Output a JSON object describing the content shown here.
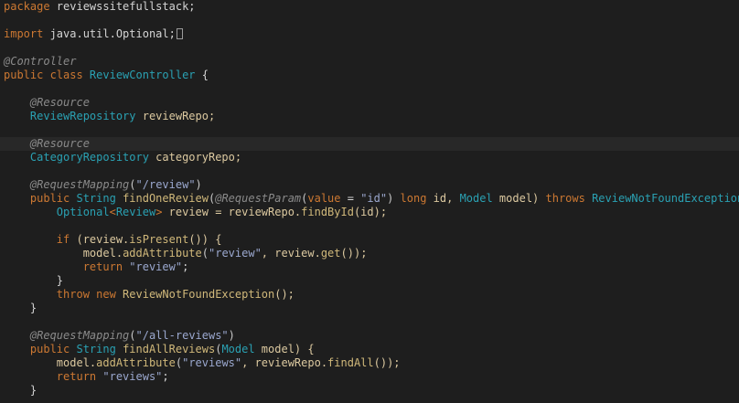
{
  "colors": {
    "background": "#1e1e1e",
    "current_line": "#282828",
    "keyword": "#cc7832",
    "plain": "#d4d4d4",
    "identifier": "#dcc9a0",
    "annotation": "#8a8a8a",
    "type": "#2aa1b3",
    "string": "#9ba8cf",
    "method": "#d0b87a",
    "punctuation": "#c8c8c8"
  },
  "editor": {
    "current_line_index": 10,
    "lines": [
      [
        {
          "t": "package",
          "c": "keyword"
        },
        {
          "t": " reviewssitefullstack;",
          "c": "plain"
        }
      ],
      [],
      [
        {
          "t": "import",
          "c": "keyword"
        },
        {
          "t": " java.util.Optional;",
          "c": "plain"
        },
        {
          "cursor": true
        }
      ],
      [],
      [
        {
          "t": "@Controller",
          "c": "annotation",
          "i": true
        }
      ],
      [
        {
          "t": "public class ",
          "c": "keyword"
        },
        {
          "t": "ReviewController",
          "c": "type"
        },
        {
          "t": " {",
          "c": "plain"
        }
      ],
      [],
      [
        {
          "t": "    "
        },
        {
          "t": "@Resource",
          "c": "annotation",
          "i": true
        }
      ],
      [
        {
          "t": "    "
        },
        {
          "t": "ReviewRepository",
          "c": "type"
        },
        {
          "t": " reviewRepo;",
          "c": "identifier"
        }
      ],
      [],
      [
        {
          "t": "    "
        },
        {
          "t": "@Resource",
          "c": "annotation",
          "i": true
        }
      ],
      [
        {
          "t": "    "
        },
        {
          "t": "CategoryRepository",
          "c": "type"
        },
        {
          "t": " categoryRepo;",
          "c": "identifier"
        }
      ],
      [],
      [
        {
          "t": "    "
        },
        {
          "t": "@RequestMapping",
          "c": "annotation",
          "i": true
        },
        {
          "t": "(",
          "c": "punctuation"
        },
        {
          "t": "\"/review\"",
          "c": "string"
        },
        {
          "t": ")",
          "c": "punctuation"
        }
      ],
      [
        {
          "t": "    "
        },
        {
          "t": "public ",
          "c": "keyword"
        },
        {
          "t": "String ",
          "c": "type"
        },
        {
          "t": "findOneReview",
          "c": "method"
        },
        {
          "t": "(",
          "c": "punctuation"
        },
        {
          "t": "@RequestParam",
          "c": "annotation",
          "i": true
        },
        {
          "t": "(",
          "c": "punctuation"
        },
        {
          "t": "value",
          "c": "keyword"
        },
        {
          "t": " = ",
          "c": "plain"
        },
        {
          "t": "\"id\"",
          "c": "string"
        },
        {
          "t": ") ",
          "c": "punctuation"
        },
        {
          "t": "long",
          "c": "keyword"
        },
        {
          "t": " id, ",
          "c": "identifier"
        },
        {
          "t": "Model",
          "c": "type"
        },
        {
          "t": " model) ",
          "c": "identifier"
        },
        {
          "t": "throws ",
          "c": "keyword"
        },
        {
          "t": "ReviewNotFoundException",
          "c": "type"
        },
        {
          "t": " {",
          "c": "plain"
        }
      ],
      [
        {
          "t": "        "
        },
        {
          "t": "Optional",
          "c": "type"
        },
        {
          "t": "<",
          "c": "keyword"
        },
        {
          "t": "Review",
          "c": "type"
        },
        {
          "t": ">",
          "c": "keyword"
        },
        {
          "t": " review = reviewRepo.",
          "c": "identifier"
        },
        {
          "t": "findById",
          "c": "method"
        },
        {
          "t": "(id);",
          "c": "identifier"
        }
      ],
      [],
      [
        {
          "t": "        "
        },
        {
          "t": "if",
          "c": "keyword"
        },
        {
          "t": " (review.",
          "c": "identifier"
        },
        {
          "t": "isPresent",
          "c": "method"
        },
        {
          "t": "()) {",
          "c": "identifier"
        }
      ],
      [
        {
          "t": "            "
        },
        {
          "t": "model.",
          "c": "identifier"
        },
        {
          "t": "addAttribute",
          "c": "method"
        },
        {
          "t": "(",
          "c": "punctuation"
        },
        {
          "t": "\"review\"",
          "c": "string"
        },
        {
          "t": ", review.",
          "c": "identifier"
        },
        {
          "t": "get",
          "c": "method"
        },
        {
          "t": "());",
          "c": "identifier"
        }
      ],
      [
        {
          "t": "            "
        },
        {
          "t": "return ",
          "c": "keyword"
        },
        {
          "t": "\"review\"",
          "c": "string"
        },
        {
          "t": ";",
          "c": "plain"
        }
      ],
      [
        {
          "t": "        "
        },
        {
          "t": "}",
          "c": "plain"
        }
      ],
      [
        {
          "t": "        "
        },
        {
          "t": "throw new ",
          "c": "keyword"
        },
        {
          "t": "ReviewNotFoundException",
          "c": "method"
        },
        {
          "t": "();",
          "c": "identifier"
        }
      ],
      [
        {
          "t": "    "
        },
        {
          "t": "}",
          "c": "plain"
        }
      ],
      [],
      [
        {
          "t": "    "
        },
        {
          "t": "@RequestMapping",
          "c": "annotation",
          "i": true
        },
        {
          "t": "(",
          "c": "punctuation"
        },
        {
          "t": "\"/all-reviews\"",
          "c": "string"
        },
        {
          "t": ")",
          "c": "punctuation"
        }
      ],
      [
        {
          "t": "    "
        },
        {
          "t": "public ",
          "c": "keyword"
        },
        {
          "t": "String ",
          "c": "type"
        },
        {
          "t": "findAllReviews",
          "c": "method"
        },
        {
          "t": "(",
          "c": "punctuation"
        },
        {
          "t": "Model",
          "c": "type"
        },
        {
          "t": " model) {",
          "c": "identifier"
        }
      ],
      [
        {
          "t": "        "
        },
        {
          "t": "model.",
          "c": "identifier"
        },
        {
          "t": "addAttribute",
          "c": "method"
        },
        {
          "t": "(",
          "c": "punctuation"
        },
        {
          "t": "\"reviews\"",
          "c": "string"
        },
        {
          "t": ", reviewRepo.",
          "c": "identifier"
        },
        {
          "t": "findAll",
          "c": "method"
        },
        {
          "t": "());",
          "c": "identifier"
        }
      ],
      [
        {
          "t": "        "
        },
        {
          "t": "return ",
          "c": "keyword"
        },
        {
          "t": "\"reviews\"",
          "c": "string"
        },
        {
          "t": ";",
          "c": "plain"
        }
      ],
      [
        {
          "t": "    "
        },
        {
          "t": "}",
          "c": "plain"
        }
      ]
    ]
  }
}
